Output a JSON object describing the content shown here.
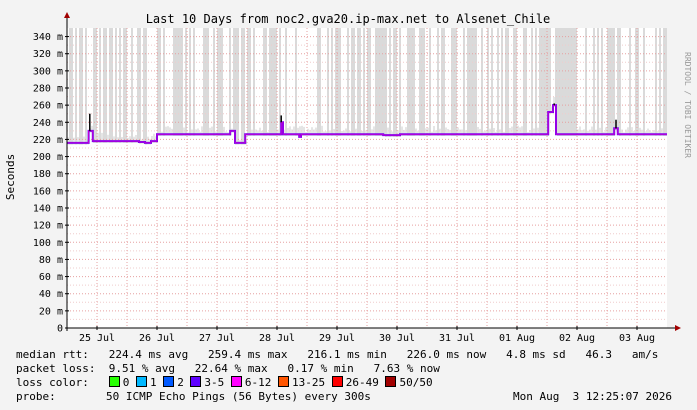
{
  "chart_data": {
    "type": "line",
    "title": "Last 10 Days from noc2.gva20.ip-max.net to Alsenet_Chile",
    "ylabel": "Seconds",
    "ylim": [
      0,
      350
    ],
    "y_ticks": [
      {
        "v": 0,
        "label": "0"
      },
      {
        "v": 20,
        "label": "20 m"
      },
      {
        "v": 40,
        "label": "40 m"
      },
      {
        "v": 60,
        "label": "60 m"
      },
      {
        "v": 80,
        "label": "80 m"
      },
      {
        "v": 100,
        "label": "100 m"
      },
      {
        "v": 120,
        "label": "120 m"
      },
      {
        "v": 140,
        "label": "140 m"
      },
      {
        "v": 160,
        "label": "160 m"
      },
      {
        "v": 180,
        "label": "180 m"
      },
      {
        "v": 200,
        "label": "200 m"
      },
      {
        "v": 220,
        "label": "220 m"
      },
      {
        "v": 240,
        "label": "240 m"
      },
      {
        "v": 260,
        "label": "260 m"
      },
      {
        "v": 280,
        "label": "280 m"
      },
      {
        "v": 300,
        "label": "300 m"
      },
      {
        "v": 320,
        "label": "320 m"
      },
      {
        "v": 340,
        "label": "340 m"
      }
    ],
    "xlim": [
      0,
      10
    ],
    "x_ticks": [
      {
        "t": 0.5,
        "label": "25 Jul"
      },
      {
        "t": 1.5,
        "label": "26 Jul"
      },
      {
        "t": 2.5,
        "label": "27 Jul"
      },
      {
        "t": 3.5,
        "label": "28 Jul"
      },
      {
        "t": 4.5,
        "label": "29 Jul"
      },
      {
        "t": 5.5,
        "label": "30 Jul"
      },
      {
        "t": 6.5,
        "label": "31 Jul"
      },
      {
        "t": 7.5,
        "label": "01 Aug"
      },
      {
        "t": 8.5,
        "label": "02 Aug"
      },
      {
        "t": 9.5,
        "label": "03 Aug"
      }
    ],
    "grid": true,
    "series": [
      {
        "name": "median rtt",
        "points": [
          [
            0.0,
            216
          ],
          [
            0.35,
            216
          ],
          [
            0.36,
            230
          ],
          [
            0.42,
            230
          ],
          [
            0.43,
            218
          ],
          [
            1.2,
            217
          ],
          [
            1.3,
            216
          ],
          [
            1.4,
            218
          ],
          [
            1.5,
            226
          ],
          [
            2.7,
            226
          ],
          [
            2.72,
            230
          ],
          [
            2.78,
            230
          ],
          [
            2.8,
            216
          ],
          [
            2.95,
            216
          ],
          [
            2.97,
            226
          ],
          [
            3.55,
            226
          ],
          [
            3.57,
            240
          ],
          [
            3.6,
            226
          ],
          [
            3.85,
            226
          ],
          [
            3.87,
            223
          ],
          [
            3.9,
            226
          ],
          [
            5.25,
            226
          ],
          [
            5.27,
            225
          ],
          [
            5.5,
            225
          ],
          [
            5.55,
            226
          ],
          [
            8.0,
            226
          ],
          [
            8.02,
            252
          ],
          [
            8.08,
            252
          ],
          [
            8.1,
            260
          ],
          [
            8.13,
            260
          ],
          [
            8.15,
            226
          ],
          [
            9.1,
            226
          ],
          [
            9.12,
            233
          ],
          [
            9.16,
            233
          ],
          [
            9.18,
            226
          ],
          [
            10.0,
            226
          ]
        ],
        "color": "#cc00cc"
      }
    ],
    "loss_spikes": [
      {
        "t": 0.38,
        "v": 250
      },
      {
        "t": 3.57,
        "v": 248
      },
      {
        "t": 8.12,
        "v": 262
      },
      {
        "t": 9.15,
        "v": 243
      }
    ],
    "smoke_band_color": "#d4d4d4"
  },
  "side_label": "RRDTOOL / TOBI OETIKER",
  "stats": {
    "median_line": "median rtt:   224.4 ms avg   259.4 ms max   216.1 ms min   226.0 ms now   4.8 ms sd   46.3   am/s",
    "loss_line": "packet loss:  9.51 % avg   22.64 % max   0.17 % min   7.63 % now",
    "loss_color_label": "loss color:",
    "probe_label": "probe:",
    "probe_text": "50 ICMP Echo Pings (56 Bytes) every 300s",
    "timestamp": "Mon Aug  3 12:25:07 2026"
  },
  "legend": [
    {
      "label": "0",
      "color": "#26ff00"
    },
    {
      "label": "1",
      "color": "#00b8ff"
    },
    {
      "label": "2",
      "color": "#0059ff"
    },
    {
      "label": "3-5",
      "color": "#5e00ff"
    },
    {
      "label": "6-12",
      "color": "#ff00ff"
    },
    {
      "label": "13-25",
      "color": "#ff5500"
    },
    {
      "label": "26-49",
      "color": "#ff0000"
    },
    {
      "label": "50/50",
      "color": "#a10000"
    }
  ]
}
